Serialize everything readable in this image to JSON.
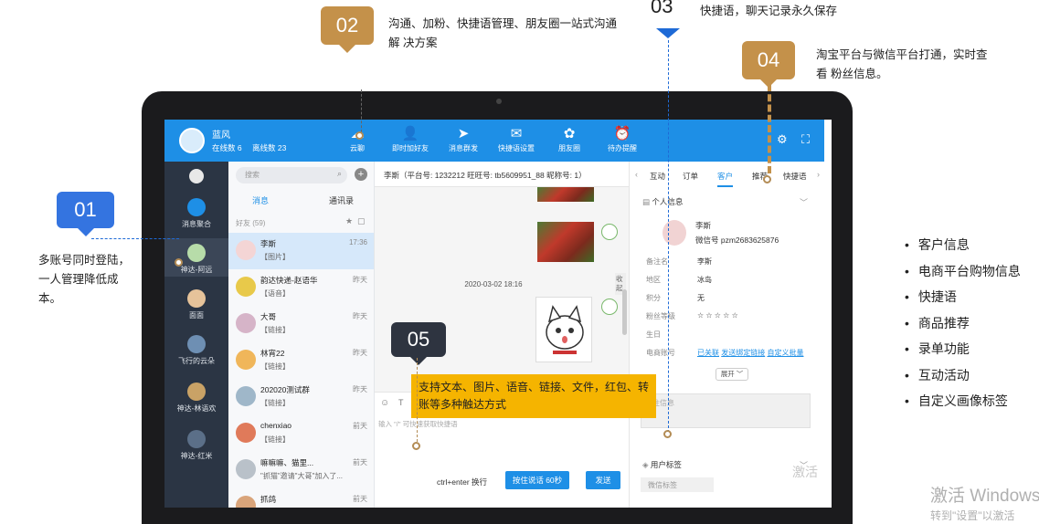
{
  "callouts": {
    "c01": {
      "num": "01",
      "text": "多账号同时登陆，一人管理降低成本。"
    },
    "c02": {
      "num": "02",
      "text": "沟通、加粉、快捷语管理、朋友圈一站式沟通解 决方案"
    },
    "c03": {
      "num": "03",
      "text": "快捷语，聊天记录永久保存"
    },
    "c04": {
      "num": "04",
      "text": "淘宝平台与微信平台打通，实时查看 粉丝信息。"
    },
    "c05": {
      "num": "05",
      "text": "支持文本、图片、语音、链接、文件，红包、转 账等多种触达方式"
    }
  },
  "app": {
    "account": {
      "name": "蓝风",
      "online": "在线数 6",
      "offline": "离线数 23"
    },
    "toolbar": [
      {
        "label": "云聊",
        "icon": "chat-cloud-icon"
      },
      {
        "label": "即时加好友",
        "icon": "add-friend-icon"
      },
      {
        "label": "消息群发",
        "icon": "send-plane-icon"
      },
      {
        "label": "快捷语设置",
        "icon": "quick-reply-icon"
      },
      {
        "label": "朋友圈",
        "icon": "moments-icon"
      },
      {
        "label": "待办提醒",
        "icon": "alarm-clock-icon"
      }
    ],
    "rail": [
      {
        "label": ""
      },
      {
        "label": "消息聚合"
      },
      {
        "label": "神达-阿远"
      },
      {
        "label": "面面"
      },
      {
        "label": "飞行的云朵"
      },
      {
        "label": "神达-林语欢"
      },
      {
        "label": "神达-红米"
      }
    ],
    "conv_list": {
      "search_placeholder": "搜索",
      "tab_messages": "消息",
      "tab_contacts": "通讯录",
      "friends_header": "好友 (59)",
      "items": [
        {
          "name": "李斯",
          "preview": "【图片】",
          "time": "17:36"
        },
        {
          "name": "韵达快递-赵语华",
          "preview": "【语音】",
          "time": "昨天"
        },
        {
          "name": "大哥",
          "preview": "【链接】",
          "time": "昨天"
        },
        {
          "name": "林宵22",
          "preview": "【链接】",
          "time": "昨天"
        },
        {
          "name": "202020测试群",
          "preview": "【链接】",
          "time": "昨天"
        },
        {
          "name": "chenxiao",
          "preview": "【链接】",
          "time": "前天"
        },
        {
          "name": "嘛嘛嘛、猫里...",
          "preview": "\"抓猫\"邀请\"大哥\"加入了...",
          "time": "前天"
        },
        {
          "name": "抓鸽",
          "preview": "",
          "time": "前天"
        }
      ]
    },
    "chat": {
      "header": "李斯（平台号: 1232212 旺旺号: tb5609951_88 昵称号: 1）",
      "date": "2020-03-02 18:16",
      "side_tab": "收起",
      "input_placeholder": "输入 \"/\" 可快速获取快捷语",
      "send_hint": "ctrl+enter 换行",
      "voice_button": "按住说话 60秒",
      "send_button": "发送"
    },
    "customer": {
      "tabs": [
        "互动",
        "订单",
        "客户",
        "推荐",
        "快捷语"
      ],
      "section_title": "个人信息",
      "name": "李斯",
      "wechat": "微信号 pzm2683625876",
      "rows": [
        {
          "label": "备注名",
          "value": "李斯"
        },
        {
          "label": "地区",
          "value": "冰岛"
        },
        {
          "label": "积分",
          "value": "无"
        },
        {
          "label": "粉丝等级",
          "value": "☆ ☆ ☆ ☆ ☆"
        },
        {
          "label": "生日",
          "value": ""
        }
      ],
      "ec_label": "电商账号",
      "ec_links": [
        "已关联",
        "发送绑定链接",
        "自定义批量"
      ],
      "expand_label": "展开 ﹀",
      "note_placeholder": "备注信息",
      "tags_title": "用户标签",
      "tags_sub": "微信标签"
    }
  },
  "features": [
    "客户信息",
    "电商平台购物信息",
    "快捷语",
    "商品推荐",
    "录单功能",
    "互动活动",
    "自定义画像标签"
  ],
  "watermark": {
    "line1": "激活 Windows",
    "line2": "转到\"设置\"以激活",
    "small": "激活"
  },
  "colors": {
    "gold": "#c4914a",
    "blue": "#3474e0",
    "dark": "#2e3440",
    "app_blue": "#1e8fe6",
    "yellow": "#f5b400"
  }
}
